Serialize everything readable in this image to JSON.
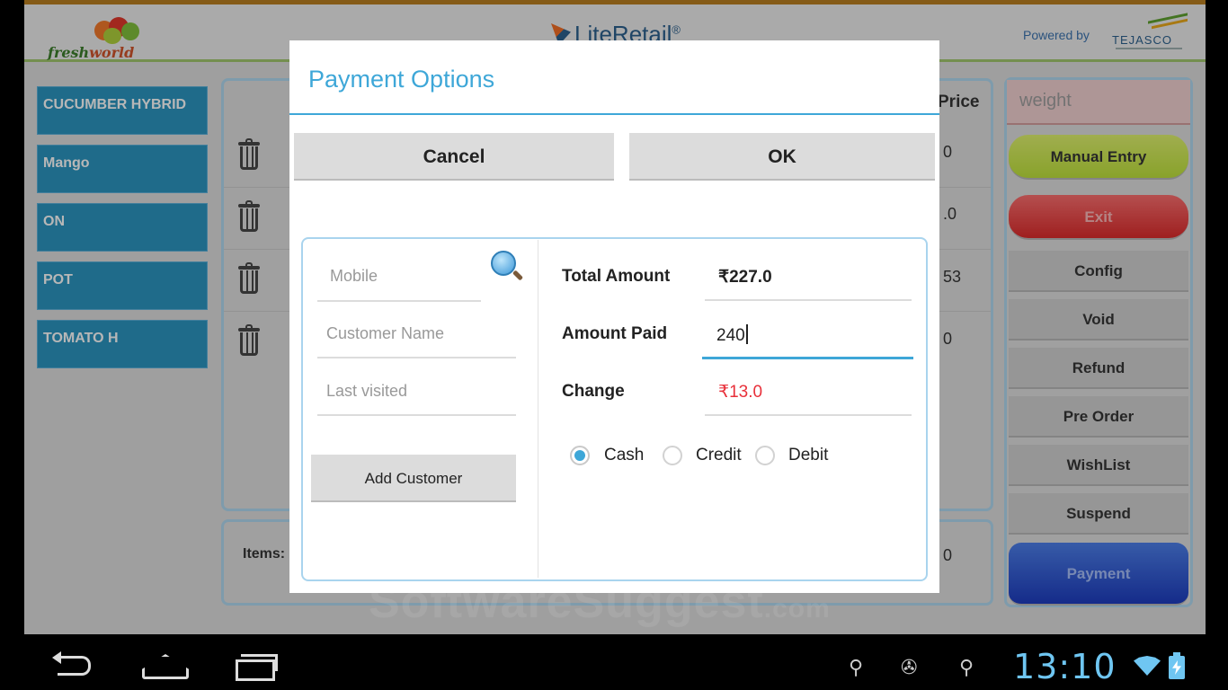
{
  "header": {
    "brand_left_fresh": "fresh",
    "brand_left_world": "world",
    "app_title": "LiteRetail",
    "app_title_mark": "®",
    "powered_by": "Powered by",
    "vendor": "TEJASCO"
  },
  "products": [
    {
      "label": "CUCUMBER HYBRID"
    },
    {
      "label": "Mango"
    },
    {
      "label": "ON"
    },
    {
      "label": "POT"
    },
    {
      "label": "TOMATO H"
    }
  ],
  "cart": {
    "price_header": "Price",
    "price_cells": [
      "0",
      ".0",
      "53",
      "0"
    ],
    "items_label": "Items:",
    "footer_value": "0"
  },
  "side": {
    "weight_placeholder": "weight",
    "manual_entry": "Manual Entry",
    "exit": "Exit",
    "config": "Config",
    "void": "Void",
    "refund": "Refund",
    "pre_order": "Pre Order",
    "wishlist": "WishList",
    "suspend": "Suspend",
    "payment": "Payment"
  },
  "dialog": {
    "title": "Payment Options",
    "cancel": "Cancel",
    "ok": "OK",
    "customer": {
      "mobile_placeholder": "Mobile",
      "name_placeholder": "Customer Name",
      "last_visited_placeholder": "Last visited",
      "add_customer": "Add Customer"
    },
    "totals": {
      "total_amount_label": "Total Amount",
      "total_amount_value": "₹227.0",
      "amount_paid_label": "Amount Paid",
      "amount_paid_value": "240",
      "change_label": "Change",
      "change_value": "₹13.0"
    },
    "payment_methods": {
      "cash": "Cash",
      "credit": "Credit",
      "debit": "Debit",
      "selected": "Cash"
    }
  },
  "watermark": {
    "main": "SoftwareSuggest",
    "suffix": ".com"
  },
  "statusbar": {
    "time": "13:10"
  },
  "colors": {
    "accent": "#3ea7d8",
    "product_tile": "#2a8fb8",
    "change_text": "#e8303a",
    "clock": "#6fc6f2"
  }
}
